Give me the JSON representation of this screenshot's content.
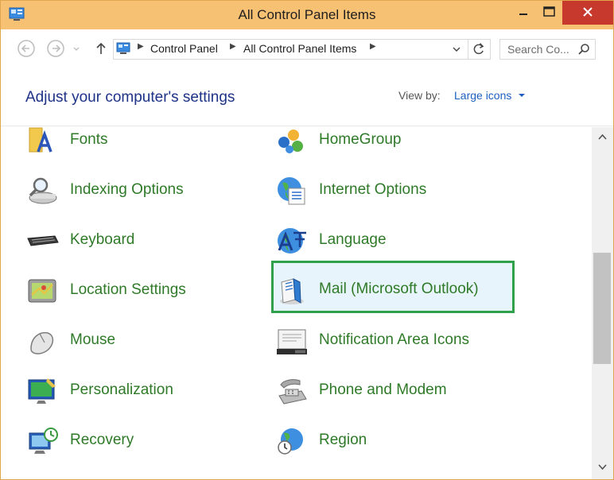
{
  "window": {
    "title": "All Control Panel Items"
  },
  "breadcrumb": [
    "Control Panel",
    "All Control Panel Items"
  ],
  "search": {
    "placeholder": "Search Co..."
  },
  "header": {
    "title": "Adjust your computer's settings",
    "view_by_label": "View by:",
    "view_by_value": "Large icons"
  },
  "items_left": [
    {
      "label": "Fonts",
      "icon": "fonts-icon"
    },
    {
      "label": "Indexing Options",
      "icon": "indexing-options-icon"
    },
    {
      "label": "Keyboard",
      "icon": "keyboard-icon"
    },
    {
      "label": "Location Settings",
      "icon": "location-settings-icon"
    },
    {
      "label": "Mouse",
      "icon": "mouse-icon"
    },
    {
      "label": "Personalization",
      "icon": "personalization-icon"
    },
    {
      "label": "Recovery",
      "icon": "recovery-icon"
    }
  ],
  "items_right": [
    {
      "label": "HomeGroup",
      "icon": "homegroup-icon"
    },
    {
      "label": "Internet Options",
      "icon": "internet-options-icon"
    },
    {
      "label": "Language",
      "icon": "language-icon"
    },
    {
      "label": "Mail (Microsoft Outlook)",
      "icon": "mail-icon",
      "selected": true
    },
    {
      "label": "Notification Area Icons",
      "icon": "notification-area-icon"
    },
    {
      "label": "Phone and Modem",
      "icon": "phone-modem-icon"
    },
    {
      "label": "Region",
      "icon": "region-icon"
    }
  ],
  "colors": {
    "titlebar": "#f7c173",
    "close_button": "#c7382d",
    "link_green": "#2f7a28",
    "heading_blue": "#1e3287",
    "selection_border": "#2fa14b"
  }
}
